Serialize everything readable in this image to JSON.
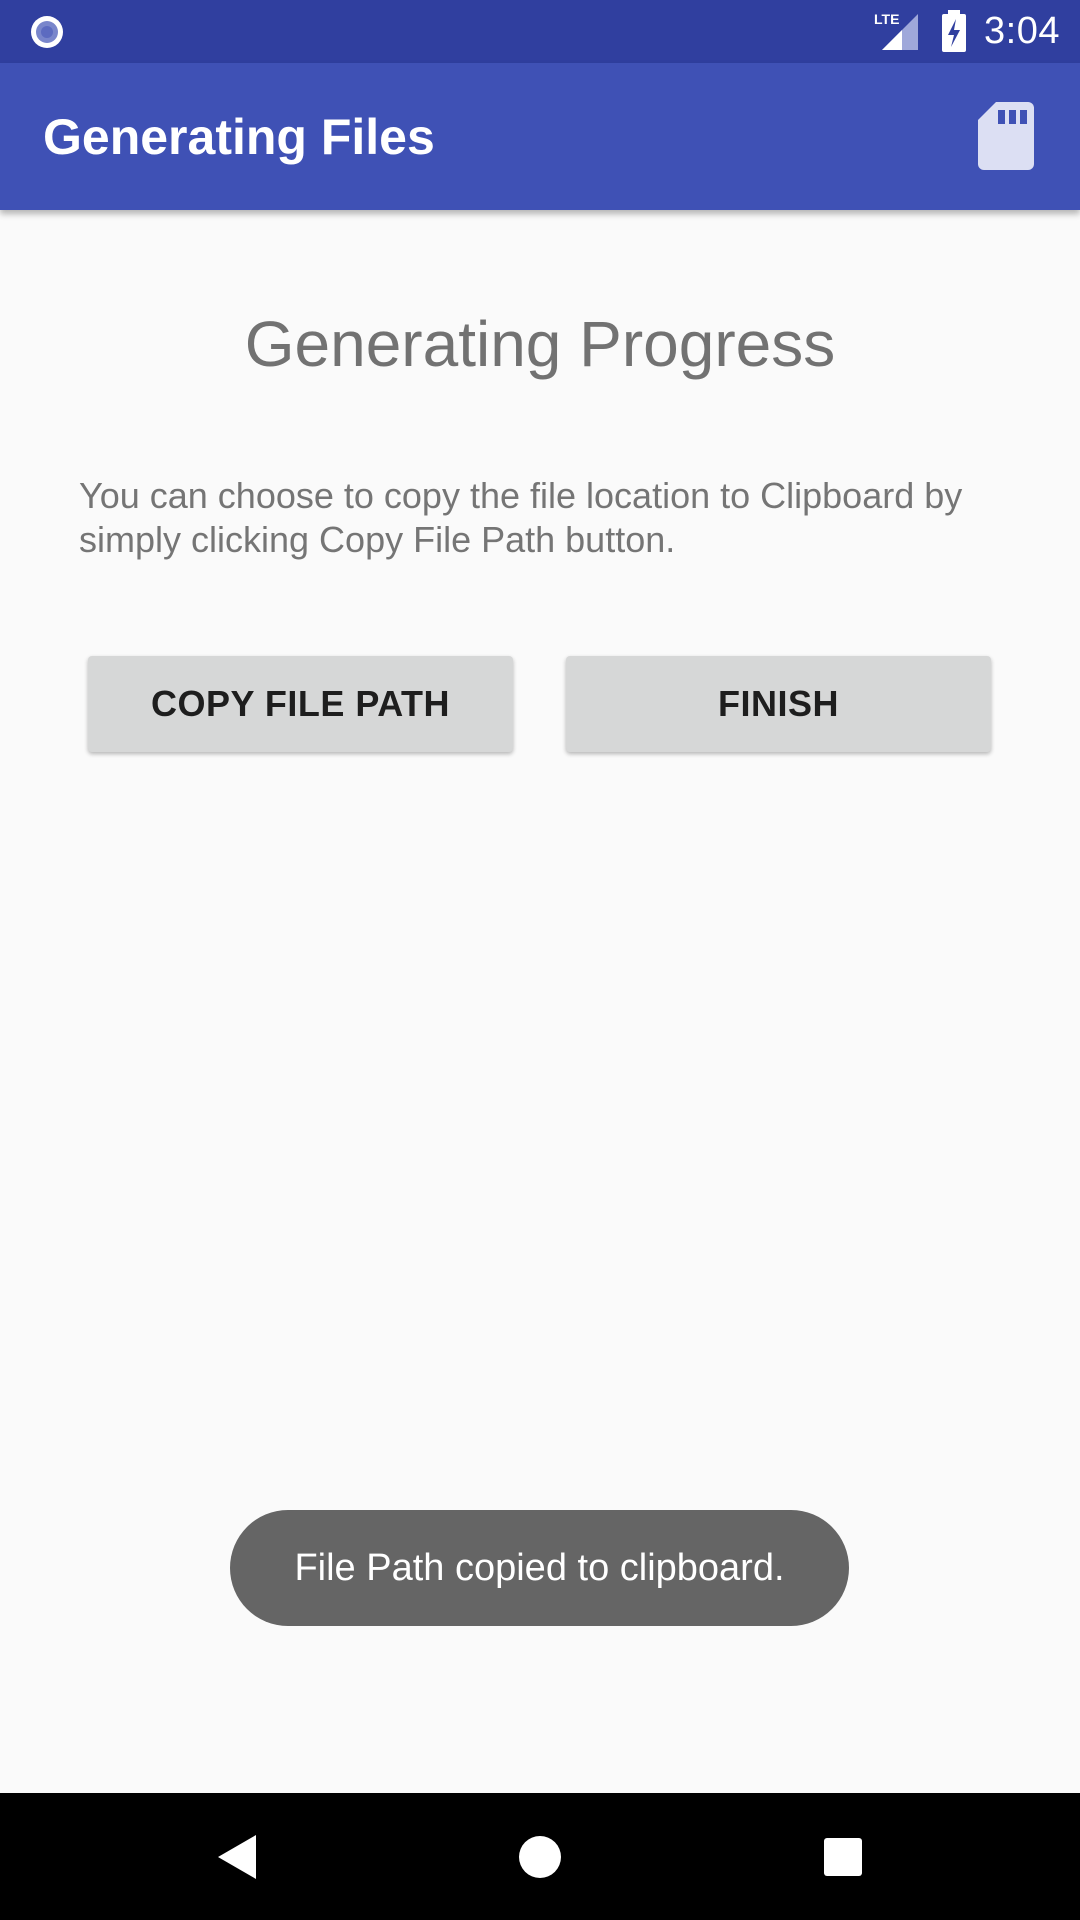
{
  "status_bar": {
    "time": "3:04",
    "network_label": "LTE",
    "icons": [
      "notification-circle-icon",
      "lte-signal-icon",
      "battery-charging-icon"
    ]
  },
  "app_bar": {
    "title": "Generating Files",
    "action_icon": "sd-card-icon"
  },
  "content": {
    "title": "Generating Progress",
    "description": "You can choose to copy the file location to Clipboard by simply clicking Copy File Path button."
  },
  "buttons": {
    "copy_label": "COPY FILE PATH",
    "finish_label": "FINISH"
  },
  "toast": {
    "message": "File Path copied to clipboard."
  },
  "nav_bar": {
    "icons": [
      "back-icon",
      "home-icon",
      "recents-icon"
    ]
  },
  "colors": {
    "status_bar": "#303f9f",
    "app_bar": "#3f51b5",
    "background": "#fafafa",
    "button": "#d6d7d7",
    "toast": "#656565"
  }
}
